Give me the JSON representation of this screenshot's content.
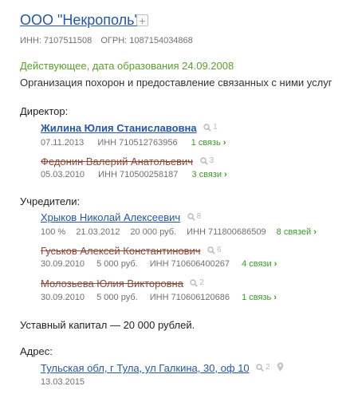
{
  "company": {
    "name": "ООО \"Некрополь\"",
    "add_icon": "+",
    "inn": "ИНН: 7107511508",
    "ogrn": "ОГРН: 1087154034868",
    "status": "Действующее, дата образования 24.09.2008",
    "activity": "Организация похорон и предоставление связанных с ними услуг"
  },
  "directors": {
    "heading": "Директор:",
    "items": [
      {
        "name": "Жилина Юлия Станиславовна",
        "count": "1",
        "date": "07.11.2013",
        "inn": "ИНН 710512763956",
        "connections": "1 связь"
      },
      {
        "name": "Федонин Валерий Анатольевич",
        "count": "3",
        "date": "05.03.2010",
        "inn": "ИНН 710500258187",
        "connections": "3 связи"
      }
    ]
  },
  "founders": {
    "heading": "Учредители:",
    "items": [
      {
        "name": "Хрыков Николай Алексеевич",
        "count": "8",
        "share": "100 %",
        "date": "21.03.2012",
        "amount": "20 000 руб.",
        "inn": "ИНН 711800686509",
        "connections": "8 связей"
      },
      {
        "name": "Гуськов Алексей Константинович",
        "count": "6",
        "date": "30.09.2010",
        "amount": "5 000 руб.",
        "inn": "ИНН 710606400267",
        "connections": "4 связи"
      },
      {
        "name": "Молозьева Юлия Викторовна",
        "count": "2",
        "date": "30.09.2010",
        "amount": "5 000 руб.",
        "inn": "ИНН 710606120686",
        "connections": "1 связь"
      }
    ]
  },
  "capital": "Уставный капитал — 20 000 рублей.",
  "address": {
    "heading": "Адрес:",
    "value": "Тульская обл, г Тула, ул Галкина, 30, оф 10",
    "count": "2",
    "date": "13.03.2015"
  },
  "colors": {
    "link": "#2457a6",
    "status_green": "#5aa02c",
    "connection_green": "#3a9a2a",
    "struck": "#8b4a3a",
    "muted": "#707070"
  },
  "icons": {
    "search": "search-icon",
    "map_pin": "map-pin-icon",
    "chevron": "chevron-right-icon",
    "add": "add-icon"
  }
}
